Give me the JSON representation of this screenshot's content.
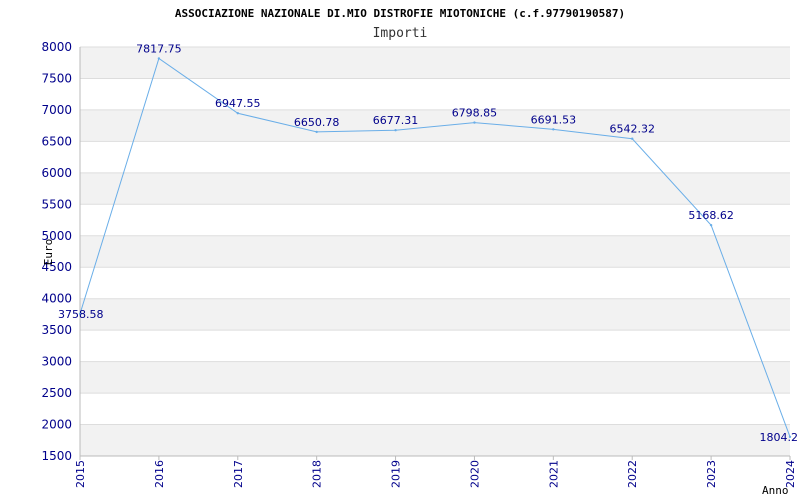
{
  "chart_data": {
    "type": "line",
    "title": "ASSOCIAZIONE NAZIONALE DI.MIO DISTROFIE MIOTONICHE (c.f.97790190587)",
    "subtitle": "Importi",
    "xlabel": "Anno",
    "ylabel": "Euro",
    "x": [
      "2015",
      "2016",
      "2017",
      "2018",
      "2019",
      "2020",
      "2021",
      "2022",
      "2023",
      "2024"
    ],
    "values": [
      3758.58,
      7817.75,
      6947.55,
      6650.78,
      6677.31,
      6798.85,
      6691.53,
      6542.32,
      5168.62,
      1804.2
    ],
    "data_labels": [
      "3758.58",
      "7817.75",
      "6947.55",
      "6650.78",
      "6677.31",
      "6798.85",
      "6691.53",
      "6542.32",
      "5168.62",
      "1804.2"
    ],
    "yticks": [
      1500,
      2000,
      2500,
      3000,
      3500,
      4000,
      4500,
      5000,
      5500,
      6000,
      6500,
      7000,
      7500,
      8000
    ],
    "ylim": [
      1500,
      8000
    ],
    "grid": "horizontal bands",
    "colors": {
      "line": "#6aaee8",
      "band": "#f2f2f2",
      "gridline": "#dddddd",
      "tick_text": "#00008b",
      "axis": "#bbbbbb"
    }
  }
}
